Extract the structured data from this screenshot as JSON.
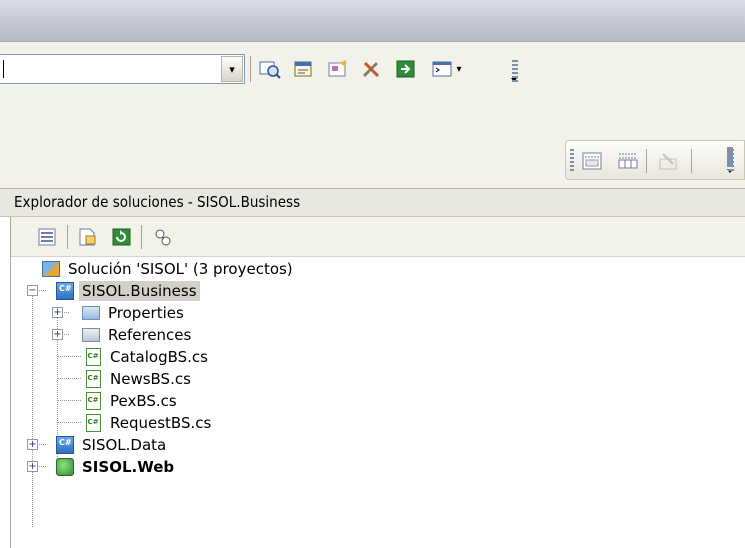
{
  "panel": {
    "title": "Explorador de soluciones - SISOL.Business"
  },
  "tree": {
    "solution": "Solución 'SISOL' (3 proyectos)",
    "project_business": "SISOL.Business",
    "properties": "Properties",
    "references": "References",
    "files": [
      "CatalogBS.cs",
      "NewsBS.cs",
      "PexBS.cs",
      "RequestBS.cs"
    ],
    "project_data": "SISOL.Data",
    "project_web": "SISOL.Web"
  },
  "icons": {
    "toolbar": [
      "find-icon",
      "properties-icon",
      "object-browser-icon",
      "toolbox-icon",
      "start-page-icon",
      "command-window-icon"
    ],
    "small_toolbar": [
      "format-left-icon",
      "format-center-icon",
      "delete-icon"
    ],
    "panel_toolbar": [
      "show-all-files-icon",
      "properties-icon",
      "refresh-icon",
      "view-class-diagram-icon"
    ]
  },
  "colors": {
    "selection": "#d4d0c8",
    "title_gradient_top": "#dadde6",
    "panel_bg": "#f2f1ea"
  }
}
